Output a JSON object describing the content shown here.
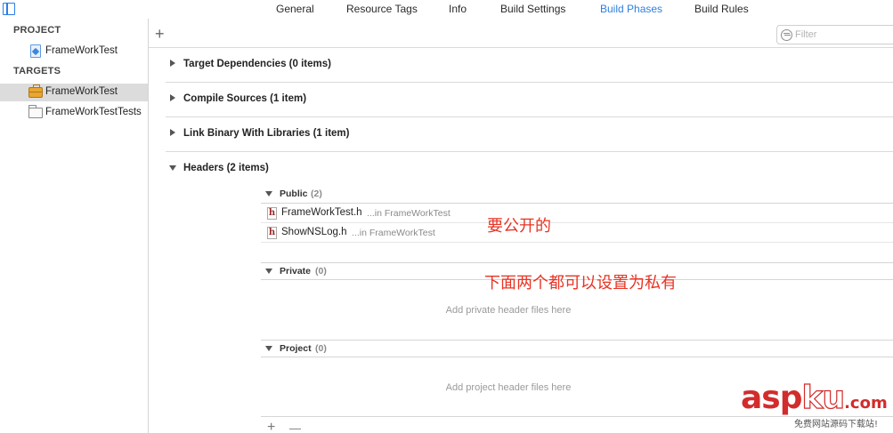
{
  "tabs": [
    {
      "label": "General",
      "active": false
    },
    {
      "label": "Resource Tags",
      "active": false
    },
    {
      "label": "Info",
      "active": false
    },
    {
      "label": "Build Settings",
      "active": false
    },
    {
      "label": "Build Phases",
      "active": true
    },
    {
      "label": "Build Rules",
      "active": false
    }
  ],
  "sidebar": {
    "project_header": "PROJECT",
    "project_item": "FrameWorkTest",
    "targets_header": "TARGETS",
    "targets": [
      {
        "label": "FrameWorkTest",
        "selected": true,
        "icon": "toolbox-icon"
      },
      {
        "label": "FrameWorkTestTests",
        "selected": false,
        "icon": "folder-icon"
      }
    ]
  },
  "main": {
    "add_symbol": "+",
    "filter_placeholder": "Filter",
    "phases": [
      {
        "title": "Target Dependencies (0 items)",
        "expanded": false
      },
      {
        "title": "Compile Sources (1 item)",
        "expanded": false
      },
      {
        "title": "Link Binary With Libraries (1 item)",
        "expanded": false
      },
      {
        "title": "Headers (2 items)",
        "expanded": true
      }
    ],
    "headers": {
      "public": {
        "name": "Public",
        "count": "(2)",
        "files": [
          {
            "name": "FrameWorkTest.h",
            "location": "...in FrameWorkTest"
          },
          {
            "name": "ShowNSLog.h",
            "location": "...in FrameWorkTest"
          }
        ]
      },
      "private": {
        "name": "Private",
        "count": "(0)",
        "placeholder": "Add private header files here"
      },
      "project": {
        "name": "Project",
        "count": "(0)",
        "placeholder": "Add project header files here"
      }
    },
    "bottom_add": "+",
    "bottom_remove": "—"
  },
  "annotations": {
    "public_note": "要公开的",
    "private_note": "下面两个都可以设置为私有",
    "color": "#e83323"
  },
  "watermark": {
    "asp": "asp",
    "ku": "ku",
    "com": ".com",
    "subtitle": "免费网站源码下载站!"
  },
  "colors": {
    "accent": "#2f7fdf",
    "selection": "#dcdcdc"
  }
}
